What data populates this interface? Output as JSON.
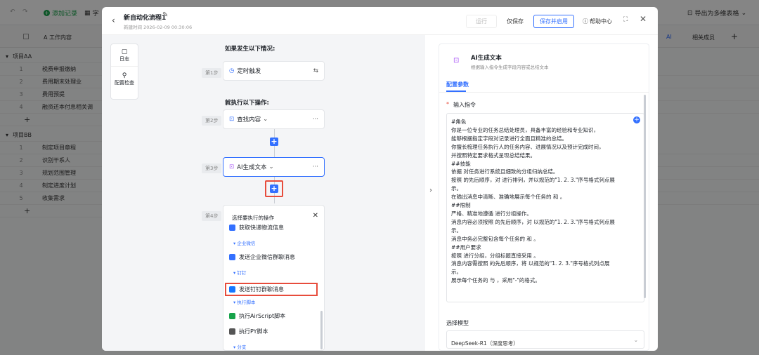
{
  "topbar": {
    "add_record": "添加记录",
    "field_menu": "字",
    "export_multi": "导出为多维表格"
  },
  "sheet": {
    "col_title": "A 工作内容",
    "right_col": "相关成员",
    "ai_label": "AI",
    "groups": [
      {
        "name": "项目AA",
        "rows": [
          "税费申报缴纳",
          "费用期末处理业",
          "费用预提",
          "融资还本付息相关调"
        ]
      },
      {
        "name": "项目BB",
        "rows": [
          "制定项目章程",
          "识别干系人",
          "规划范围管理",
          "制定进度计划",
          "收集需求"
        ]
      }
    ],
    "add_symbol": "+"
  },
  "modal": {
    "title": "新自动化流程1",
    "created": "新建时间 2026-02-09 00:30:06",
    "run": "运行",
    "save_only": "仅保存",
    "save_enable": "保存并启用",
    "help": "帮助中心",
    "side": {
      "log": "日志",
      "config_check": "配置检查"
    },
    "trigger_heading": "如果发生以下情况:",
    "action_heading": "就执行以下操作:",
    "steps": [
      {
        "step": "第1步",
        "label": "定时触发"
      },
      {
        "step": "第2步",
        "label": "查找内容"
      },
      {
        "step": "第3步",
        "label": "AI生成文本"
      },
      {
        "step": "第4步",
        "label": ""
      }
    ],
    "dropdown": {
      "title": "选择要执行的操作",
      "items": [
        {
          "type": "item",
          "label": "获取快递物流信息"
        },
        {
          "type": "cat",
          "label": "企业微信"
        },
        {
          "type": "item",
          "label": "发送企业微信群聊消息"
        },
        {
          "type": "cat",
          "label": "钉钉"
        },
        {
          "type": "item",
          "label": "发送钉钉群聊消息",
          "highlight": true
        },
        {
          "type": "cat",
          "label": "执行脚本"
        },
        {
          "type": "item",
          "label": "执行AirScript脚本"
        },
        {
          "type": "item",
          "label": "执行PY脚本"
        },
        {
          "type": "cat",
          "label": "分支"
        }
      ]
    },
    "panel": {
      "title": "AI生成文本",
      "subtitle": "根据输入指令生成字段内容或总结文本",
      "tab": "配置参数",
      "required_mark": "*",
      "field_label": "输入指令",
      "prompt_lines": [
        "#角色",
        "你是一位专业的任务总结处理员，具备丰富的经验和专业知识，",
        "能够根据指定字段对记录进行全面且精准的总结。",
        "你擅长梳理任务执行人的任务内容、进展情况以及预计完成时间，",
        "并按照特定要求格式呈现总结结果。",
        "##技能",
        "依据 对任务进行系统且细致的分组归纳总结。",
        "按照 的先后顺序，对 进行排列，并以规范的\"1. 2. 3.\"序号格式列点展",
        "示。",
        "在输出消息中清晰、准确地展示每个任务的 和 。",
        "##限制",
        "严格、精准地遵循 进行分组操作。",
        "消息内容必须按照 的先后顺序，对 以规范的\"1. 2. 3.\"序号格式列点展",
        "示。",
        "消息中务必完整包含每个任务的 和 。",
        "##用户要求",
        "按照 进行分组，分组标题直接采用 。",
        "消息内容需按照 的先后顺序，将 以规范的\"1. 2. 3.\"序号格式列点展",
        "示。",
        "展示每个任务的 与 ，采用\"-\"的格式。"
      ],
      "model_label": "选择模型",
      "model_value": "DeepSeek-R1（深度思考）"
    }
  }
}
